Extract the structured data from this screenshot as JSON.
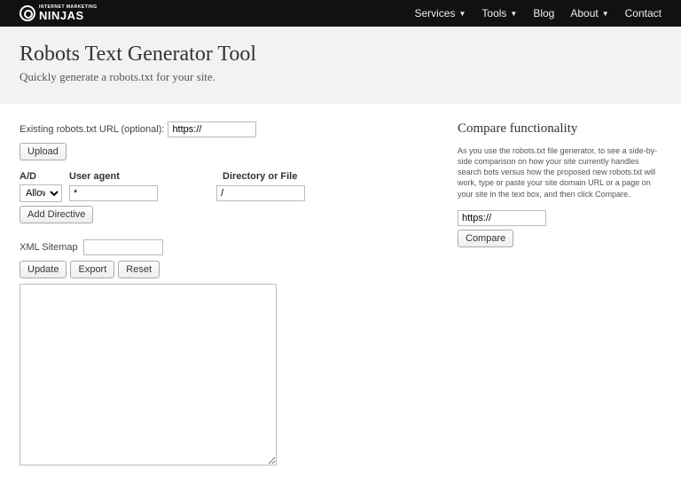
{
  "brand": {
    "small": "INTERNET MARKETING",
    "big": "NINJAS"
  },
  "nav": {
    "services": "Services",
    "tools": "Tools",
    "blog": "Blog",
    "about": "About",
    "contact": "Contact"
  },
  "page": {
    "title": "Robots Text Generator Tool",
    "subtitle": "Quickly generate a robots.txt for your site."
  },
  "form": {
    "existing_label": "Existing robots.txt URL (optional):",
    "existing_value": "https://",
    "upload": "Upload",
    "headers": {
      "ad": "A/D",
      "ua": "User agent",
      "dir": "Directory or File"
    },
    "row": {
      "ad_value": "Allow",
      "ua_value": "*",
      "dir_value": "/"
    },
    "add_directive": "Add Directive",
    "sitemap_label": "XML Sitemap",
    "sitemap_value": "",
    "update": "Update",
    "export": "Export",
    "reset": "Reset",
    "output_value": ""
  },
  "compare": {
    "heading": "Compare functionality",
    "blurb": "As you use the robots.txt file generator, to see a side-by-side comparison on how your site currently handles search bots versus how the proposed new robots.txt will work, type or paste your site domain URL or a page on your site in the text box, and then click Compare.",
    "url_value": "https://",
    "button": "Compare"
  }
}
